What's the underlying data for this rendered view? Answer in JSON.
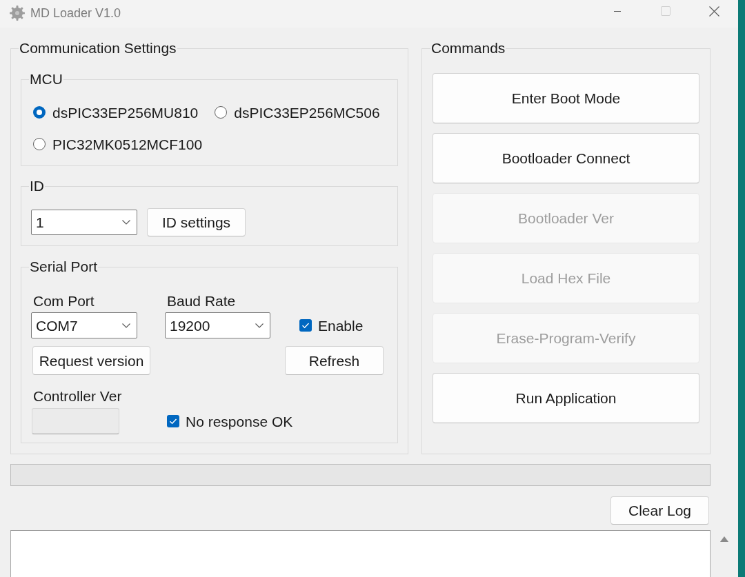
{
  "window": {
    "title": "MD Loader V1.0",
    "controls": [
      {
        "kind": "minimize",
        "disabled": false
      },
      {
        "kind": "maximize",
        "disabled": true
      },
      {
        "kind": "close",
        "disabled": false
      }
    ]
  },
  "communication_settings": {
    "title": "Communication Settings",
    "mcu": {
      "title": "MCU",
      "options": [
        {
          "label": "dsPIC33EP256MU810",
          "selected": true
        },
        {
          "label": "dsPIC33EP256MC506",
          "selected": false
        },
        {
          "label": "PIC32MK0512MCF100",
          "selected": false
        }
      ]
    },
    "id": {
      "title": "ID",
      "select": {
        "value": "1"
      },
      "button": {
        "label": "ID settings"
      }
    },
    "serial_port": {
      "title": "Serial Port",
      "com_port": {
        "label": "Com Port",
        "value": "COM7"
      },
      "baud_rate": {
        "label": "Baud Rate",
        "value": "19200"
      },
      "enable": {
        "label": "Enable",
        "checked": true
      },
      "request_button": {
        "label": "Request version"
      },
      "refresh_button": {
        "label": "Refresh"
      },
      "controller_ver": {
        "label": "Controller Ver",
        "disabled": true
      },
      "no_response_ok": {
        "label": "No response OK",
        "checked": true
      }
    }
  },
  "commands": {
    "title": "Commands",
    "buttons": [
      {
        "label": "Enter Boot Mode",
        "disabled": false
      },
      {
        "label": "Bootloader Connect",
        "disabled": false
      },
      {
        "label": "Bootloader Ver",
        "disabled": true
      },
      {
        "label": "Load Hex File",
        "disabled": true
      },
      {
        "label": "Erase-Program-Verify",
        "disabled": true
      },
      {
        "label": "Run Application",
        "disabled": false
      }
    ]
  },
  "progress": {
    "level": 0
  },
  "log": {
    "button": {
      "label": "Clear Log"
    }
  }
}
